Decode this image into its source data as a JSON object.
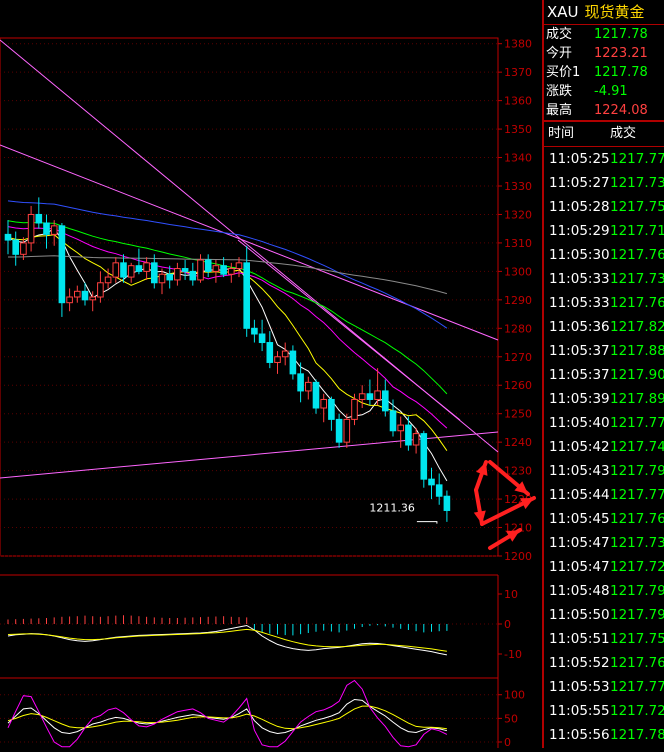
{
  "symbol": "XAU",
  "name": "现货黄金",
  "quote": [
    {
      "label": "成交",
      "value": "1217.78",
      "color": "#00ff00"
    },
    {
      "label": "今开",
      "value": "1223.21",
      "color": "#ff4040"
    },
    {
      "label": "买价1",
      "value": "1217.78",
      "color": "#00ff00"
    },
    {
      "label": "涨跌",
      "value": "-4.91",
      "color": "#00ff00"
    },
    {
      "label": "最高",
      "value": "1224.08",
      "color": "#ff4040"
    }
  ],
  "ticks_header": {
    "time": "时间",
    "price": "成交"
  },
  "ticks": [
    {
      "time": "11:05:25",
      "price": "1217.77"
    },
    {
      "time": "11:05:27",
      "price": "1217.73"
    },
    {
      "time": "11:05:28",
      "price": "1217.75"
    },
    {
      "time": "11:05:29",
      "price": "1217.71"
    },
    {
      "time": "11:05:30",
      "price": "1217.76"
    },
    {
      "time": "11:05:33",
      "price": "1217.73"
    },
    {
      "time": "11:05:33",
      "price": "1217.76"
    },
    {
      "time": "11:05:36",
      "price": "1217.82"
    },
    {
      "time": "11:05:37",
      "price": "1217.88"
    },
    {
      "time": "11:05:37",
      "price": "1217.90"
    },
    {
      "time": "11:05:39",
      "price": "1217.89"
    },
    {
      "time": "11:05:40",
      "price": "1217.77"
    },
    {
      "time": "11:05:42",
      "price": "1217.74"
    },
    {
      "time": "11:05:43",
      "price": "1217.79"
    },
    {
      "time": "11:05:44",
      "price": "1217.77"
    },
    {
      "time": "11:05:45",
      "price": "1217.76"
    },
    {
      "time": "11:05:47",
      "price": "1217.73"
    },
    {
      "time": "11:05:47",
      "price": "1217.72"
    },
    {
      "time": "11:05:48",
      "price": "1217.79"
    },
    {
      "time": "11:05:50",
      "price": "1217.79"
    },
    {
      "time": "11:05:51",
      "price": "1217.75"
    },
    {
      "time": "11:05:52",
      "price": "1217.76"
    },
    {
      "time": "11:05:53",
      "price": "1217.77"
    },
    {
      "time": "11:05:55",
      "price": "1217.72"
    },
    {
      "time": "11:05:56",
      "price": "1217.78"
    }
  ],
  "tick_color": "#00ff00",
  "chart_data": [
    {
      "type": "candlestick",
      "price_axis_ticks": [
        1380,
        1370,
        1360,
        1350,
        1340,
        1330,
        1320,
        1310,
        1300,
        1290,
        1280,
        1270,
        1260,
        1250,
        1240,
        1230,
        1220,
        1210,
        1200
      ],
      "ylim": [
        1200,
        1382
      ],
      "low_annotation": "1211.36",
      "low_value": 1211.36,
      "candles": [
        [
          1313,
          1318,
          1306,
          1311
        ],
        [
          1311,
          1314,
          1302,
          1306
        ],
        [
          1306,
          1312,
          1304,
          1310
        ],
        [
          1310,
          1323,
          1307,
          1320
        ],
        [
          1320,
          1326,
          1315,
          1317
        ],
        [
          1317,
          1320,
          1308,
          1313
        ],
        [
          1313,
          1318,
          1309,
          1316
        ],
        [
          1316,
          1317,
          1284,
          1289
        ],
        [
          1289,
          1294,
          1286,
          1291
        ],
        [
          1291,
          1295,
          1289,
          1293
        ],
        [
          1293,
          1296,
          1288,
          1290
        ],
        [
          1290,
          1293,
          1286,
          1291
        ],
        [
          1291,
          1300,
          1289,
          1296
        ],
        [
          1296,
          1301,
          1294,
          1298
        ],
        [
          1298,
          1305,
          1296,
          1303
        ],
        [
          1303,
          1306,
          1296,
          1298
        ],
        [
          1298,
          1303,
          1296,
          1302
        ],
        [
          1302,
          1308,
          1299,
          1300
        ],
        [
          1300,
          1305,
          1297,
          1303
        ],
        [
          1303,
          1306,
          1294,
          1296
        ],
        [
          1296,
          1301,
          1292,
          1299
        ],
        [
          1299,
          1302,
          1294,
          1297
        ],
        [
          1297,
          1303,
          1295,
          1301
        ],
        [
          1301,
          1304,
          1297,
          1300
        ],
        [
          1300,
          1303,
          1295,
          1297
        ],
        [
          1297,
          1306,
          1296,
          1304
        ],
        [
          1304,
          1306,
          1298,
          1300
        ],
        [
          1300,
          1304,
          1296,
          1302
        ],
        [
          1302,
          1305,
          1298,
          1299
        ],
        [
          1299,
          1303,
          1296,
          1301
        ],
        [
          1301,
          1305,
          1298,
          1303
        ],
        [
          1303,
          1309,
          1277,
          1280
        ],
        [
          1280,
          1283,
          1275,
          1278
        ],
        [
          1278,
          1283,
          1272,
          1275
        ],
        [
          1275,
          1279,
          1266,
          1268
        ],
        [
          1268,
          1272,
          1264,
          1270
        ],
        [
          1270,
          1275,
          1267,
          1272
        ],
        [
          1272,
          1274,
          1262,
          1264
        ],
        [
          1264,
          1268,
          1254,
          1258
        ],
        [
          1258,
          1263,
          1255,
          1261
        ],
        [
          1261,
          1262,
          1250,
          1252
        ],
        [
          1252,
          1257,
          1247,
          1255
        ],
        [
          1255,
          1256,
          1244,
          1248
        ],
        [
          1248,
          1250,
          1238,
          1240
        ],
        [
          1240,
          1250,
          1238,
          1248
        ],
        [
          1248,
          1257,
          1246,
          1255
        ],
        [
          1255,
          1260,
          1252,
          1257
        ],
        [
          1257,
          1262,
          1253,
          1255
        ],
        [
          1255,
          1266,
          1253,
          1258
        ],
        [
          1258,
          1262,
          1249,
          1251
        ],
        [
          1251,
          1255,
          1242,
          1244
        ],
        [
          1244,
          1249,
          1238,
          1246
        ],
        [
          1246,
          1249,
          1237,
          1239
        ],
        [
          1239,
          1245,
          1236,
          1243
        ],
        [
          1243,
          1244,
          1224,
          1227
        ],
        [
          1227,
          1231,
          1220,
          1225
        ],
        [
          1225,
          1229,
          1218,
          1221
        ],
        [
          1221,
          1223,
          1212,
          1216
        ]
      ],
      "macd_axis_ticks": [
        "10",
        "0",
        "-10"
      ],
      "macd_ylim": [
        -12,
        13
      ],
      "macd_hist": [
        1.5,
        1.6,
        1.7,
        1.8,
        1.9,
        2,
        2.2,
        2.4,
        2.5,
        2.6,
        2.8,
        2.6,
        2.4,
        2.6,
        2.8,
        2.9,
        2.8,
        2.6,
        2.4,
        2.2,
        2.1,
        2,
        2,
        2.1,
        2.2,
        2.3,
        2.4,
        2.5,
        2.6,
        2.4,
        2.3,
        2.2,
        -2,
        -2.8,
        -3.2,
        -3.5,
        -3.7,
        -3.8,
        -3.4,
        -3,
        -2.6,
        -2.2,
        -2.5,
        -2.8,
        -2.2,
        -1.6,
        -1,
        -0.6,
        -0.4,
        -0.8,
        -1.2,
        -1.6,
        -2,
        -2.4,
        -2.8,
        -2.6,
        -2.4,
        -2.3
      ],
      "macd_dif": [
        -4,
        -3.6,
        -3.4,
        -3.2,
        -3.3,
        -3.6,
        -4,
        -4.6,
        -5.2,
        -5.6,
        -5.8,
        -5.6,
        -5.2,
        -4.8,
        -4.4,
        -4.2,
        -4,
        -3.8,
        -3.7,
        -3.6,
        -3.5,
        -3.4,
        -3.3,
        -3.2,
        -3.1,
        -3,
        -2.8,
        -2.5,
        -2,
        -1.5,
        -1,
        -0.5,
        -2,
        -4,
        -5.5,
        -6.8,
        -7.6,
        -8.2,
        -8.6,
        -8.8,
        -8.6,
        -8.2,
        -8,
        -7.8,
        -7.4,
        -7,
        -6.6,
        -6.4,
        -6.5,
        -6.8,
        -7.2,
        -7.6,
        -8,
        -8.4,
        -8.8,
        -9.2,
        -9.8,
        -10.3
      ],
      "macd_dea": [
        -3.5,
        -3.4,
        -3.3,
        -3.3,
        -3.4,
        -3.6,
        -3.9,
        -4.3,
        -4.7,
        -5,
        -5.2,
        -5.2,
        -5.1,
        -4.9,
        -4.6,
        -4.4,
        -4.2,
        -4,
        -3.9,
        -3.8,
        -3.7,
        -3.6,
        -3.5,
        -3.4,
        -3.3,
        -3.2,
        -3,
        -2.9,
        -2.7,
        -2.4,
        -2.1,
        -1.8,
        -2.1,
        -2.8,
        -3.6,
        -4.4,
        -5.2,
        -5.9,
        -6.5,
        -7,
        -7.3,
        -7.5,
        -7.6,
        -7.6,
        -7.5,
        -7.3,
        -7.1,
        -6.9,
        -6.8,
        -6.8,
        -7,
        -7.2,
        -7.4,
        -7.7,
        -8,
        -8.3,
        -8.7,
        -9.1
      ],
      "kdj_axis_ticks": [
        "100",
        "50",
        "0"
      ],
      "kdj_ylim": [
        0,
        110
      ],
      "kdj_k": [
        40,
        55,
        70,
        72,
        60,
        45,
        30,
        20,
        18,
        22,
        30,
        38,
        42,
        48,
        52,
        50,
        45,
        40,
        38,
        40,
        44,
        48,
        52,
        55,
        58,
        56,
        52,
        50,
        48,
        52,
        60,
        70,
        45,
        30,
        22,
        18,
        20,
        26,
        34,
        40,
        46,
        50,
        55,
        62,
        80,
        90,
        88,
        75,
        65,
        55,
        42,
        30,
        22,
        20,
        26,
        30,
        28,
        24
      ],
      "kdj_d": [
        45,
        50,
        56,
        60,
        58,
        52,
        45,
        38,
        32,
        30,
        30,
        32,
        35,
        38,
        42,
        44,
        44,
        43,
        41,
        41,
        42,
        44,
        46,
        49,
        52,
        53,
        53,
        52,
        51,
        51,
        54,
        59,
        55,
        48,
        40,
        33,
        29,
        28,
        30,
        33,
        37,
        41,
        45,
        50,
        60,
        70,
        76,
        76,
        72,
        66,
        58,
        49,
        40,
        33,
        31,
        31,
        30,
        28
      ],
      "kdj_j": [
        30,
        65,
        98,
        96,
        64,
        31,
        0,
        -12,
        -10,
        6,
        30,
        50,
        56,
        68,
        72,
        62,
        47,
        34,
        32,
        38,
        48,
        56,
        64,
        67,
        70,
        62,
        50,
        46,
        42,
        54,
        72,
        92,
        25,
        -6,
        -14,
        -12,
        2,
        22,
        42,
        54,
        64,
        68,
        75,
        86,
        120,
        130,
        112,
        73,
        51,
        33,
        10,
        -8,
        -14,
        -6,
        16,
        28,
        24,
        16
      ]
    }
  ]
}
